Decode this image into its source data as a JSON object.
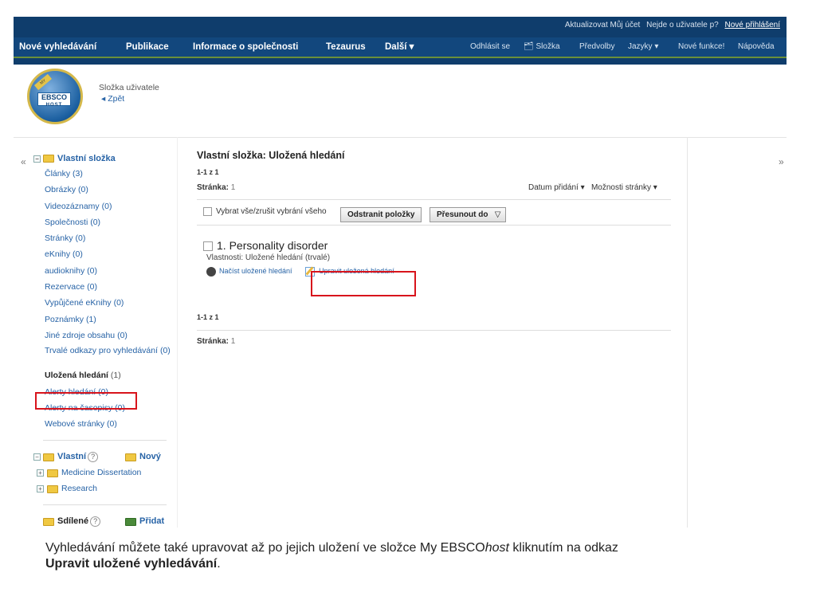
{
  "top_links": {
    "update_account": "Aktualizovat Můj účet",
    "not_user": "Nejde o uživatele p?",
    "new_login": "Nové přihlášení"
  },
  "nav": {
    "left": [
      "Nové vyhledávání",
      "Publikace",
      "Informace o společnosti",
      "Tezaurus",
      "Další ▾"
    ],
    "right": [
      "Odhlásit se",
      "Složka",
      "Předvolby",
      "Jazyky ▾",
      "Nové funkce!",
      "Nápověda"
    ]
  },
  "header": {
    "folder_title": "Složka uživatele",
    "back": "◂ Zpět",
    "logo_main": "EBSCO",
    "logo_sub": "HOST"
  },
  "sidebar": {
    "my_folder": "Vlastní složka",
    "items": [
      {
        "label": "Články",
        "count": " (3)"
      },
      {
        "label": "Obrázky",
        "count": " (0)"
      },
      {
        "label": "Videozáznamy",
        "count": " (0)"
      },
      {
        "label": "Společnosti",
        "count": " (0)"
      },
      {
        "label": "Stránky",
        "count": " (0)"
      },
      {
        "label": "eKnihy",
        "count": " (0)"
      },
      {
        "label": "audioknihy",
        "count": " (0)"
      },
      {
        "label": "Rezervace",
        "count": " (0)"
      },
      {
        "label": "Vypůjčené eKnihy",
        "count": " (0)"
      },
      {
        "label": "Poznámky",
        "count": " (1)"
      },
      {
        "label": "Jiné zdroje obsahu",
        "count": " (0)"
      },
      {
        "label": "Trvalé odkazy pro vyhledávání",
        "count": " (0)"
      },
      {
        "label": "Uložená hledání",
        "count": " (1)"
      },
      {
        "label": "Alerty hledání",
        "count": " (0)"
      },
      {
        "label": "Alerty na časopisy",
        "count": " (0)"
      },
      {
        "label": "Webové stránky",
        "count": " (0)"
      }
    ],
    "own": "Vlastní",
    "new": "Nový",
    "own_folders": [
      "Medicine Dissertation",
      "Research"
    ],
    "shared": "Sdílené",
    "add": "Přidat"
  },
  "content": {
    "title": "Vlastní složka: Uložená hledání",
    "count": "1-1 z 1",
    "page_label": "Stránka:",
    "page_num": "1",
    "sort": "Datum přidání ▾",
    "options": "Možnosti stránky ▾",
    "select_all": "Vybrat vše/zrušit vybrání všeho",
    "remove_btn": "Odstranit položky",
    "move_btn": "Přesunout do",
    "result_title": "1. Personality disorder",
    "result_prop": "Vlastnosti: Uložené hledání (trvalé)",
    "load_link": "Načíst uložené hledání",
    "edit_link": "Upravit uložená hledání",
    "count_bottom": "1-1 z 1",
    "page_label_bottom": "Stránka:",
    "page_num_bottom": "1"
  },
  "caption": {
    "part1": "Vyhledávání můžete také upravovat až po jejich uložení ve složce My EBSCO",
    "italic": "host",
    "part2": " kliknutím na odkaz",
    "bold": "Upravit uložené vyhledávání",
    "end": "."
  },
  "colors": {
    "nav_bg": "#12477d",
    "highlight": "#d8141c",
    "link": "#2763a6"
  }
}
